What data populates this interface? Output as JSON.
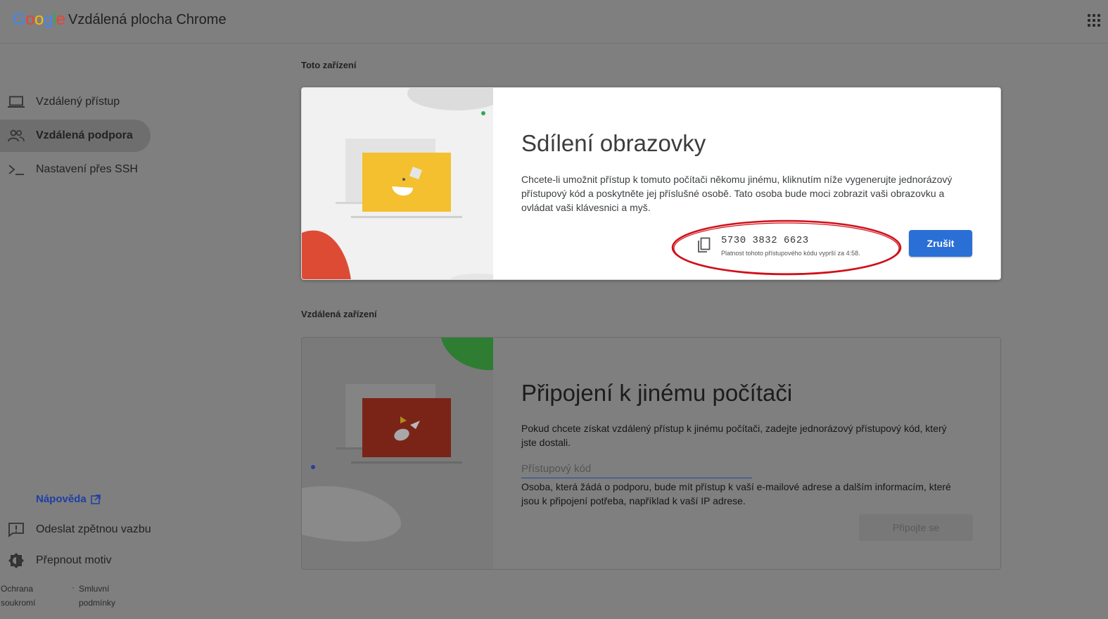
{
  "header": {
    "logo_letters": [
      "G",
      "o",
      "o",
      "g",
      "l",
      "e"
    ],
    "logo_colors": [
      "#4285f4",
      "#ea4335",
      "#fbbc05",
      "#4285f4",
      "#34a853",
      "#ea4335"
    ],
    "app_title": "Vzdálená plocha Chrome",
    "apps_icon": "apps-grid-icon"
  },
  "sidebar": {
    "items": [
      {
        "label": "Vzdálený přístup",
        "icon": "laptop-icon",
        "active": false
      },
      {
        "label": "Vzdálená podpora",
        "icon": "people-icon",
        "active": true
      },
      {
        "label": "Nastavení přes SSH",
        "icon": "terminal-icon",
        "active": false
      }
    ],
    "help_label": "Nápověda",
    "feedback_label": "Odeslat zpětnou vazbu",
    "theme_label": "Přepnout motiv",
    "footer": {
      "privacy_line1": "Ochrana",
      "privacy_line2": "soukromí",
      "separator": "·",
      "terms_line1": "Smluvní",
      "terms_line2": "podmínky"
    }
  },
  "main": {
    "this_device_label": "Toto zařízení",
    "share": {
      "title": "Sdílení obrazovky",
      "description": "Chcete-li umožnit přístup k tomuto počítači někomu jinému, kliknutím níže vygenerujte jednorázový přístupový kód a poskytněte jej příslušné osobě. Tato osoba bude moci zobrazit vaši obrazovku a ovládat vaši klávesnici a myš.",
      "access_code": "5730 3832 6623",
      "expiry_text": "Platnost tohoto přístupového kódu vyprší za 4:58.",
      "cancel_label": "Zrušit",
      "highlight_color": "#d0101a"
    },
    "remote_devices_label": "Vzdálená zařízení",
    "connect": {
      "title": "Připojení k jinému počítači",
      "description": "Pokud chcete získat vzdálený přístup k jinému počítači, zadejte jednorázový přístupový kód, který jste dostali.",
      "input_placeholder": "Přístupový kód",
      "input_value": "",
      "notice": "Osoba, která žádá o podporu, bude mít přístup k vaší e-mailové adrese a dalším informacím, které jsou k připojení potřeba, například k vaší IP adrese.",
      "connect_label": "Připojte se"
    }
  },
  "colors": {
    "accent_blue": "#2a6fd6",
    "illus_yellow": "#f4c02f",
    "illus_red": "#dd4b35",
    "illus_green": "#2e7d32",
    "illus_dark_red": "#7a2418"
  }
}
